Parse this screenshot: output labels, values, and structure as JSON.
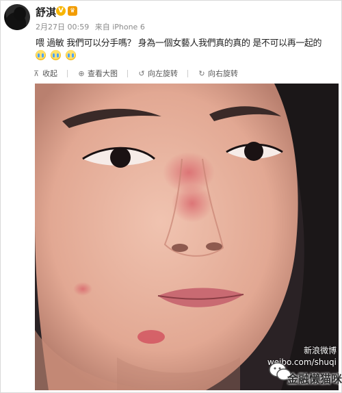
{
  "post": {
    "author": "舒淇",
    "verified_badge": "V",
    "member_badge": "♛",
    "date": "2月27日 00:59",
    "source": "来自 iPhone 6",
    "text": "喂 過敏 我們可以分手嗎？ 身為一個女藝人我們真的真的 是不可以再一起的",
    "emoji_count": 3,
    "emoji_name": "crying-face-icon"
  },
  "toolbar": {
    "collapse": {
      "label": "收起",
      "icon": "collapse-arrow-icon"
    },
    "view_large": {
      "label": "查看大图",
      "icon": "zoom-icon"
    },
    "rotate_left": {
      "label": "向左旋转",
      "icon": "rotate-left-icon"
    },
    "rotate_right": {
      "label": "向右旋转",
      "icon": "rotate-right-icon"
    }
  },
  "photo": {
    "watermark_line1": "新浪微博",
    "watermark_line2": "weibo.com/shuqi",
    "wechat_watermark": "金融懒猫咪"
  },
  "colors": {
    "badge_gold": "#f7b500",
    "text_dark": "#222222",
    "meta_gray": "#8a8a8a",
    "skin": "#e9b7a3",
    "hair": "#1e1a1b"
  }
}
